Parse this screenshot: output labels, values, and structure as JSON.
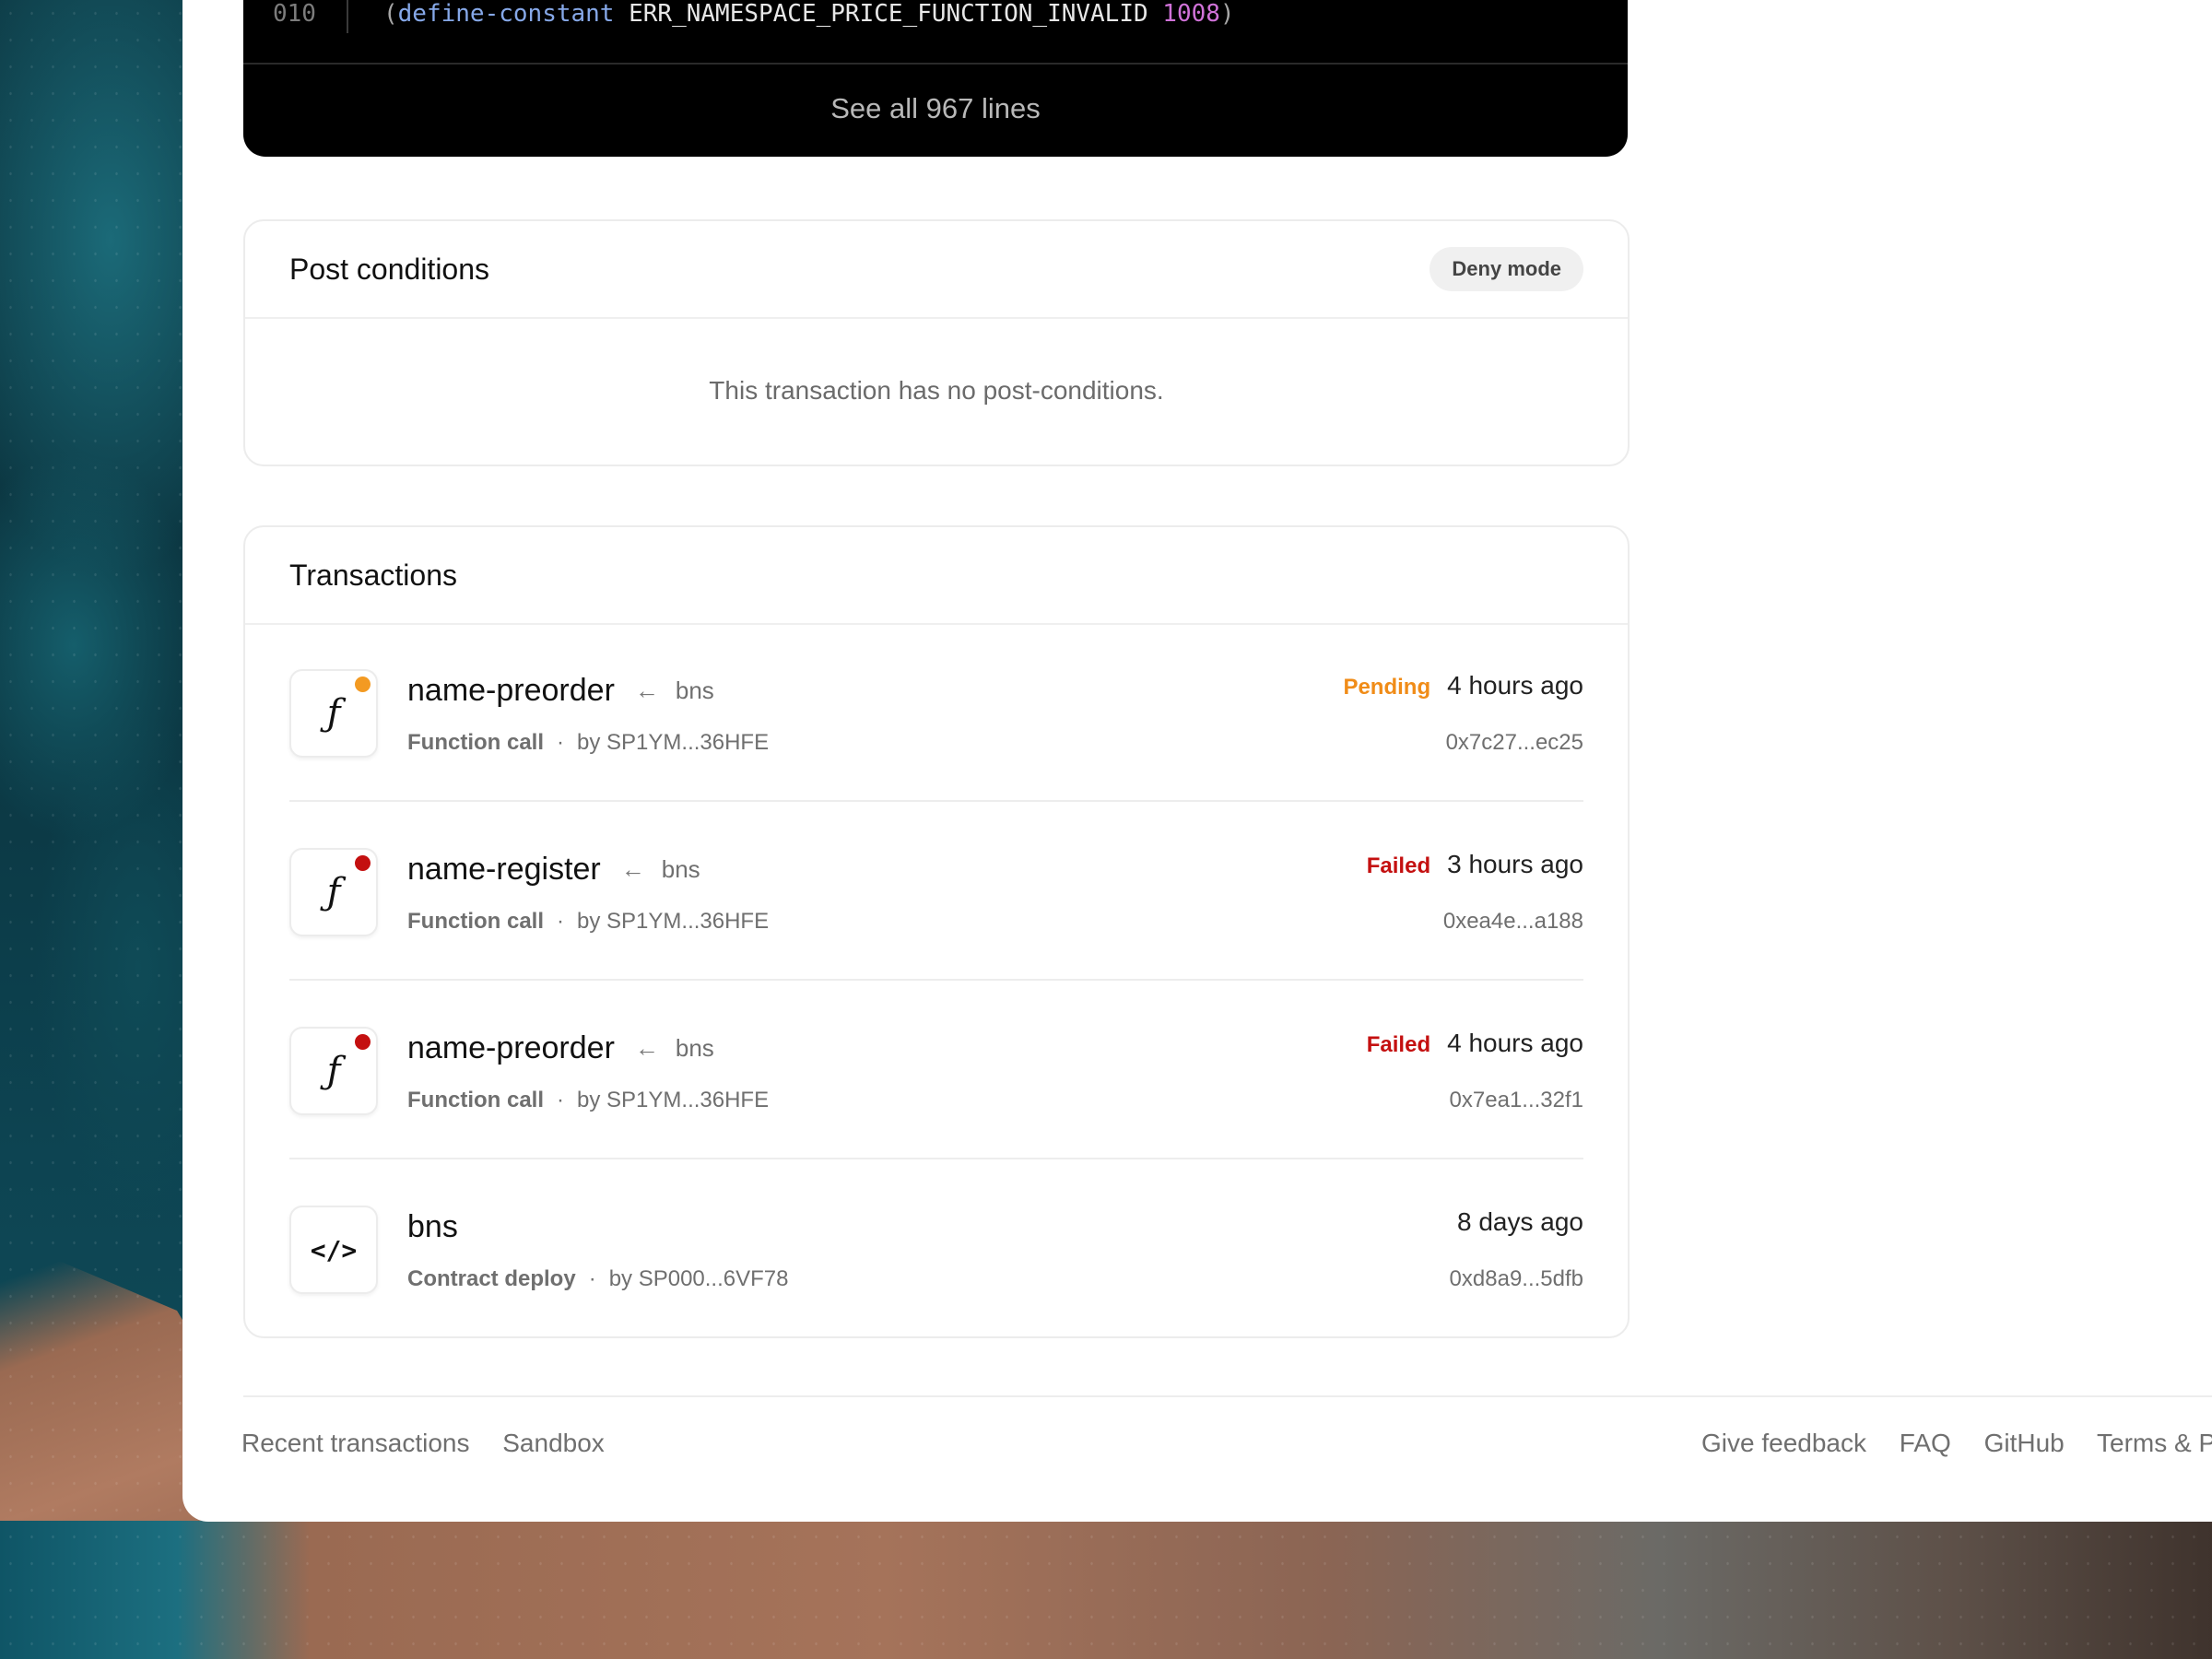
{
  "code": {
    "line_number": "010",
    "paren_open": "(",
    "keyword": "define-constant",
    "name": " ERR_NAMESPACE_PRICE_FUNCTION_INVALID ",
    "value": "1008",
    "paren_close": ")",
    "see_all_label": "See all 967 lines"
  },
  "post_conditions": {
    "title": "Post conditions",
    "mode_badge": "Deny mode",
    "empty_message": "This transaction has no post-conditions."
  },
  "transactions": {
    "title": "Transactions",
    "items": [
      {
        "icon": "function-icon",
        "glyph": "ƒ",
        "name": "name-preorder",
        "arrow": "←",
        "contract": "bns",
        "type": "Function call",
        "separator": "·",
        "sender": "by SP1YM...36HFE",
        "status": "Pending",
        "time": "4 hours ago",
        "hash": "0x7c27...ec25"
      },
      {
        "icon": "function-icon",
        "glyph": "ƒ",
        "name": "name-register",
        "arrow": "←",
        "contract": "bns",
        "type": "Function call",
        "separator": "·",
        "sender": "by SP1YM...36HFE",
        "status": "Failed",
        "time": "3 hours ago",
        "hash": "0xea4e...a188"
      },
      {
        "icon": "function-icon",
        "glyph": "ƒ",
        "name": "name-preorder",
        "arrow": "←",
        "contract": "bns",
        "type": "Function call",
        "separator": "·",
        "sender": "by SP1YM...36HFE",
        "status": "Failed",
        "time": "4 hours ago",
        "hash": "0x7ea1...32f1"
      },
      {
        "icon": "code-icon",
        "glyph": "</>",
        "name": "bns",
        "type": "Contract deploy",
        "separator": "·",
        "sender": "by SP000...6VF78",
        "time": "8 days ago",
        "hash": "0xd8a9...5dfb"
      }
    ]
  },
  "footer": {
    "left": [
      "Recent transactions",
      "Sandbox"
    ],
    "right": [
      "Give feedback",
      "FAQ",
      "GitHub",
      "Terms & Privacy"
    ]
  },
  "colors": {
    "pending": "#f08c18",
    "failed": "#c41010",
    "code_keyword": "#86a8e8",
    "code_number": "#d072d8"
  }
}
